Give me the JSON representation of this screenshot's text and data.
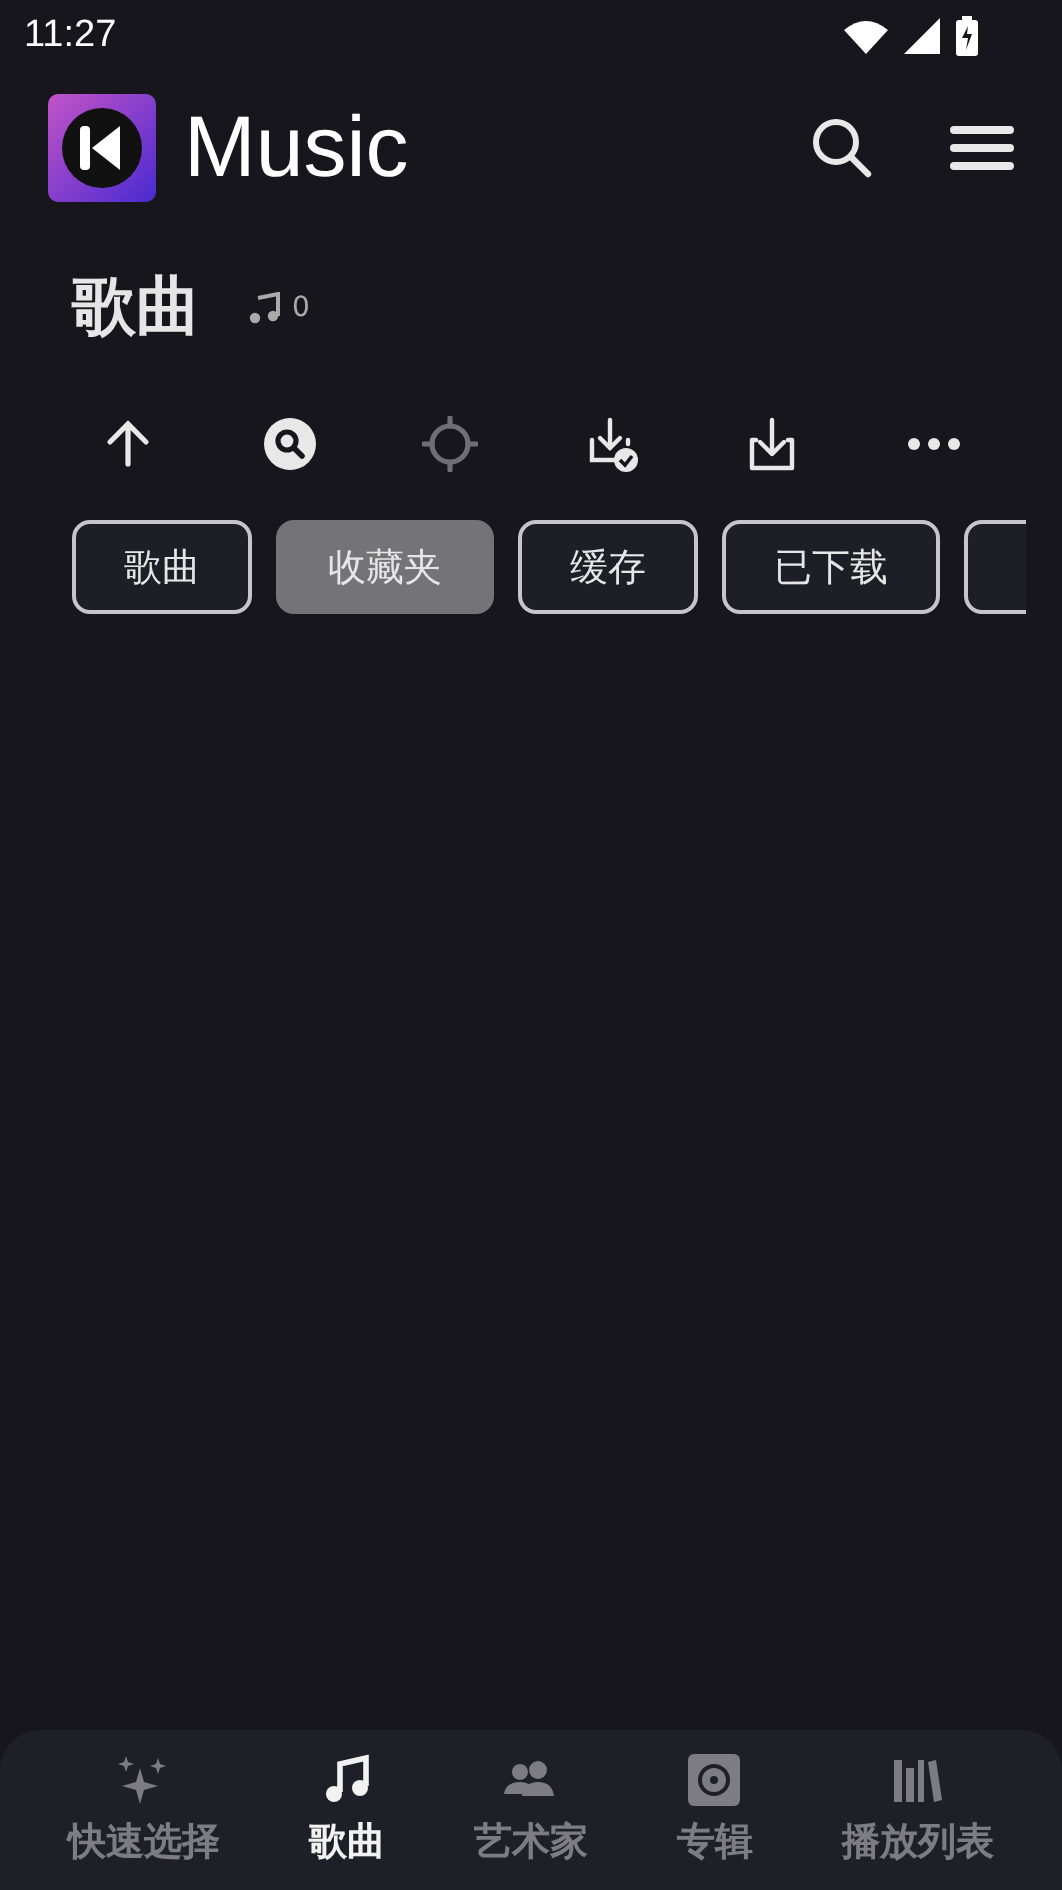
{
  "status_bar": {
    "time": "11:27"
  },
  "header": {
    "app_name": "Music"
  },
  "section": {
    "title": "歌曲",
    "count": "0"
  },
  "toolbar": [
    {
      "kind": "up",
      "disabled": false
    },
    {
      "kind": "search",
      "disabled": false
    },
    {
      "kind": "locate",
      "disabled": true
    },
    {
      "kind": "downloaded",
      "disabled": false
    },
    {
      "kind": "download",
      "disabled": false
    },
    {
      "kind": "more",
      "disabled": false
    }
  ],
  "chips": [
    {
      "label": "歌曲",
      "selected": false
    },
    {
      "label": "收藏夹",
      "selected": true
    },
    {
      "label": "缓存",
      "selected": false
    },
    {
      "label": "已下载",
      "selected": false
    },
    {
      "selected": false
    }
  ],
  "bottom_nav": [
    {
      "kind": "sparkle",
      "label": "快速选择",
      "selected": false
    },
    {
      "kind": "note",
      "label": "歌曲",
      "selected": true
    },
    {
      "kind": "people",
      "label": "艺术家",
      "selected": false
    },
    {
      "kind": "album",
      "label": "专辑",
      "selected": false
    },
    {
      "kind": "library",
      "label": "播放列表",
      "selected": false
    }
  ]
}
